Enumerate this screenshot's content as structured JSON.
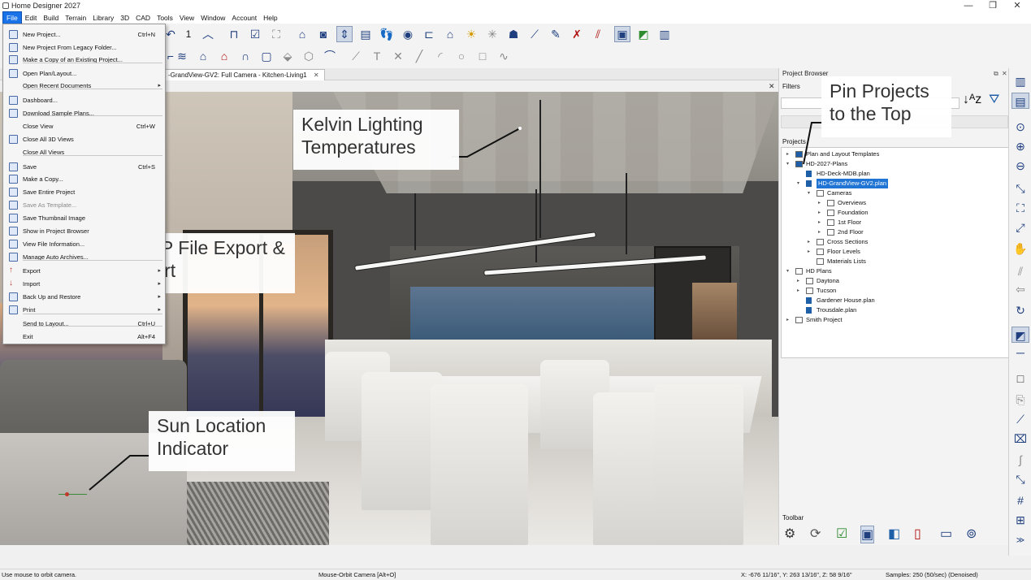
{
  "window": {
    "title": "Home Designer 2027",
    "min": "—",
    "max": "❐",
    "close": "✕"
  },
  "menubar": [
    "File",
    "Edit",
    "Build",
    "Terrain",
    "Library",
    "3D",
    "CAD",
    "Tools",
    "View",
    "Window",
    "Account",
    "Help"
  ],
  "toolbar1": {
    "number_label": "1"
  },
  "tabs": {
    "active": "-GrandView-GV2: Full Camera - Kitchen-Living1",
    "close": "✕"
  },
  "file_menu": {
    "items": [
      {
        "label": "New Project...",
        "shortcut": "Ctrl+N"
      },
      {
        "label": "New Project From Legacy Folder...",
        "shortcut": ""
      },
      {
        "label": "Make a Copy of an Existing Project...",
        "shortcut": ""
      },
      {
        "label": "Open Plan/Layout...",
        "shortcut": ""
      },
      {
        "label": "Open Recent Documents",
        "shortcut": ""
      },
      {
        "label": "Dashboard...",
        "shortcut": ""
      },
      {
        "label": "Download Sample Plans...",
        "shortcut": ""
      },
      {
        "label": "Close View",
        "shortcut": "Ctrl+W"
      },
      {
        "label": "Close All 3D Views",
        "shortcut": ""
      },
      {
        "label": "Close All Views",
        "shortcut": ""
      },
      {
        "label": "Save",
        "shortcut": "Ctrl+S"
      },
      {
        "label": "Make a Copy...",
        "shortcut": ""
      },
      {
        "label": "Save Entire Project",
        "shortcut": ""
      },
      {
        "label": "Save As Template...",
        "shortcut": ""
      },
      {
        "label": "Save Thumbnail Image",
        "shortcut": ""
      },
      {
        "label": "Show in Project Browser",
        "shortcut": ""
      },
      {
        "label": "View File Information...",
        "shortcut": ""
      },
      {
        "label": "Manage Auto Archives...",
        "shortcut": ""
      },
      {
        "label": "Export",
        "shortcut": ""
      },
      {
        "label": "Import",
        "shortcut": ""
      },
      {
        "label": "Back Up and Restore",
        "shortcut": ""
      },
      {
        "label": "Print",
        "shortcut": ""
      },
      {
        "label": "Send to Layout...",
        "shortcut": "Ctrl+U"
      },
      {
        "label": "Exit",
        "shortcut": "Alt+F4"
      }
    ]
  },
  "callouts": {
    "kelvin": "Kelvin Lighting Temperatures",
    "webp": "WebP File Export & Import",
    "sun": "Sun Location Indicator",
    "pin": "Pin Projects to the Top"
  },
  "project_browser": {
    "title": "Project Browser",
    "filters_label": "Filters",
    "projects_label": "Projects",
    "toolbar_label": "Toolbar",
    "tree": [
      "Plan and Layout Templates",
      "HD-2027-Plans",
      "HD-Deck-MDB.plan",
      "HD-GrandView-GV2.plan",
      "Cameras",
      "Overviews",
      "Foundation",
      "1st Floor",
      "2nd Floor",
      "Cross Sections",
      "Floor Levels",
      "Materials Lists",
      "HD Plans",
      "Daytona",
      "Tucson",
      "Gardener House.plan",
      "Trousdale.plan",
      "Smith Project"
    ]
  },
  "statusbar": {
    "left": "Use mouse to orbit camera.",
    "mode": "Mouse-Orbit Camera [Alt+O]",
    "coords": "X: -676 11/16\", Y: 263 13/16\", Z: 58 9/16\"",
    "samples": "Samples: 250 (50/sec) (Denoised)"
  }
}
